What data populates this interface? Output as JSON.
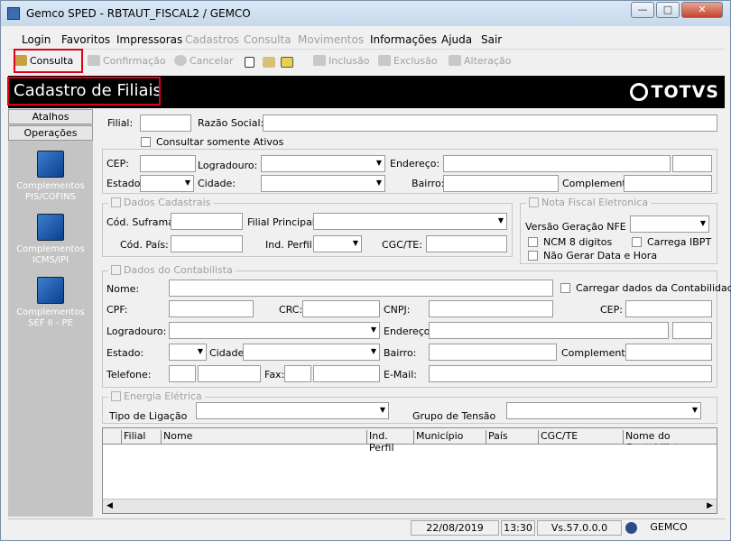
{
  "window": {
    "title": "Gemco SPED - RBTAUT_FISCAL2 / GEMCO",
    "min": "—",
    "max": "□",
    "close": "✕"
  },
  "menu": [
    {
      "label": "Login",
      "enabled": true
    },
    {
      "label": "Favoritos",
      "enabled": true
    },
    {
      "label": "Impressoras",
      "enabled": true
    },
    {
      "label": "Cadastros",
      "enabled": false
    },
    {
      "label": "Consulta",
      "enabled": false
    },
    {
      "label": "Movimentos",
      "enabled": false
    },
    {
      "label": "Informações",
      "enabled": true
    },
    {
      "label": "Ajuda",
      "enabled": true
    },
    {
      "label": "Sair",
      "enabled": true
    }
  ],
  "toolbar": {
    "consulta": "Consulta",
    "confirmacao": "Confirmação",
    "cancelar": "Cancelar",
    "inclusao": "Inclusão",
    "exclusao": "Exclusão",
    "alteracao": "Alteração"
  },
  "header": {
    "title": "Cadastro de Filiais",
    "logo": "TOTVS"
  },
  "sidebar": {
    "tabs": [
      "Atalhos",
      "Operações"
    ],
    "items": [
      {
        "line1": "Complementos",
        "line2": "PIS/COFINS"
      },
      {
        "line1": "Complementos",
        "line2": "ICMS/IPI"
      },
      {
        "line1": "Complementos",
        "line2": "SEF II - PE"
      }
    ]
  },
  "form": {
    "filial": "Filial:",
    "razao_social": "Razão Social:",
    "consultar_ativos": "Consultar somente Ativos",
    "cep": "CEP:",
    "logradouro": "Logradouro:",
    "endereco": "Endereço:",
    "estado": "Estado:",
    "cidade": "Cidade:",
    "bairro": "Bairro:",
    "complemento": "Complemento",
    "dados_cadastrais": "Dados Cadastrais",
    "cod_suframa": "Cód. Suframa:",
    "filial_principal": "Filial Principal:",
    "cod_pais": "Cód. País:",
    "ind_perfil": "Ind. Perfil:",
    "cgc_te": "CGC/TE:",
    "nota_fiscal": "Nota Fiscal Eletronica",
    "versao_nfe": "Versão Geração NFE",
    "ncm8": "NCM 8 digitos",
    "carrega_ibpt": "Carrega IBPT",
    "nao_gerar_data": "Não Gerar Data e Hora",
    "dados_contabilista": "Dados do Contabilista",
    "nome": "Nome:",
    "carregar_contabilidade": "Carregar dados da Contabilidade",
    "cpf": "CPF:",
    "crc": "CRC:",
    "cnpj": "CNPJ:",
    "cep2": "CEP:",
    "logradouro2": "Logradouro:",
    "endereco2": "Endereço:",
    "estado2": "Estado:",
    "cidade2": "Cidade:",
    "bairro2": "Bairro:",
    "complemento2": "Complemento:",
    "telefone": "Telefone:",
    "fax": "Fax:",
    "email": "E-Mail:",
    "energia": "Energia Elétrica",
    "tipo_ligacao": "Tipo de Ligação",
    "grupo_tensao": "Grupo de Tensão"
  },
  "grid": {
    "columns": [
      "Filial",
      "Nome",
      "Ind. Perfil",
      "Município",
      "País",
      "CGC/TE",
      "Nome do Contabilista"
    ]
  },
  "status": {
    "date": "22/08/2019",
    "time": "13:30",
    "version": "Vs.57.0.0.0",
    "user": "GEMCO"
  }
}
